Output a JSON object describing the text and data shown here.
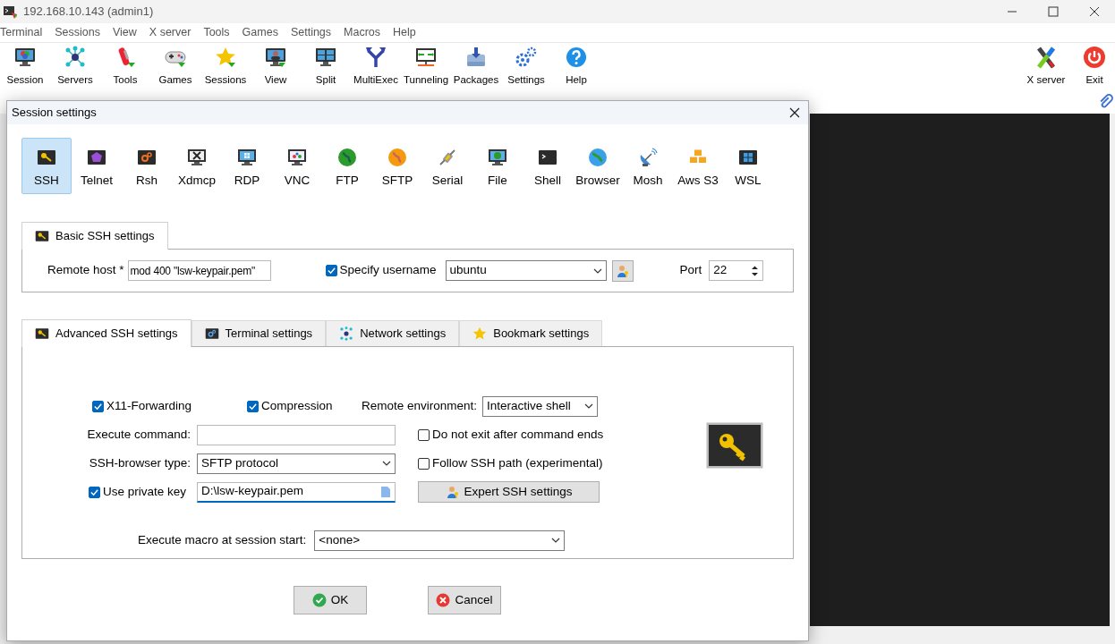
{
  "window": {
    "title": "192.168.10.143 (admin1)"
  },
  "menu": [
    "Terminal",
    "Sessions",
    "View",
    "X server",
    "Tools",
    "Games",
    "Settings",
    "Macros",
    "Help"
  ],
  "toolbar": [
    {
      "label": "Session",
      "kind": "session"
    },
    {
      "label": "Servers",
      "kind": "servers"
    },
    {
      "label": "Tools",
      "kind": "tools"
    },
    {
      "label": "Games",
      "kind": "games"
    },
    {
      "label": "Sessions",
      "kind": "sessions"
    },
    {
      "label": "View",
      "kind": "view"
    },
    {
      "label": "Split",
      "kind": "split"
    },
    {
      "label": "MultiExec",
      "kind": "multiexec"
    },
    {
      "label": "Tunneling",
      "kind": "tunneling"
    },
    {
      "label": "Packages",
      "kind": "packages"
    },
    {
      "label": "Settings",
      "kind": "settings"
    },
    {
      "label": "Help",
      "kind": "help"
    }
  ],
  "toolbar_right": [
    {
      "label": "X server",
      "kind": "xserver"
    },
    {
      "label": "Exit",
      "kind": "exit"
    }
  ],
  "dialog": {
    "title": "Session settings",
    "session_types": [
      {
        "label": "SSH",
        "kind": "ssh",
        "selected": true
      },
      {
        "label": "Telnet",
        "kind": "telnet",
        "selected": false
      },
      {
        "label": "Rsh",
        "kind": "rsh",
        "selected": false
      },
      {
        "label": "Xdmcp",
        "kind": "xdmcp",
        "selected": false
      },
      {
        "label": "RDP",
        "kind": "rdp",
        "selected": false
      },
      {
        "label": "VNC",
        "kind": "vnc",
        "selected": false
      },
      {
        "label": "FTP",
        "kind": "ftp",
        "selected": false
      },
      {
        "label": "SFTP",
        "kind": "sftp",
        "selected": false
      },
      {
        "label": "Serial",
        "kind": "serial",
        "selected": false
      },
      {
        "label": "File",
        "kind": "file",
        "selected": false
      },
      {
        "label": "Shell",
        "kind": "shell",
        "selected": false
      },
      {
        "label": "Browser",
        "kind": "browser",
        "selected": false
      },
      {
        "label": "Mosh",
        "kind": "mosh",
        "selected": false
      },
      {
        "label": "Aws S3",
        "kind": "awss3",
        "selected": false
      },
      {
        "label": "WSL",
        "kind": "wsl",
        "selected": false
      }
    ],
    "basic_tab": {
      "label": "Basic SSH settings"
    },
    "remote_host": {
      "label": "Remote host *",
      "value": "mod 400 \"lsw-keypair.pem\""
    },
    "specify_username": {
      "label": "Specify username",
      "checked": true
    },
    "username": {
      "value": "ubuntu"
    },
    "port": {
      "label": "Port",
      "value": "22"
    },
    "advanced_tabs": [
      {
        "label": "Advanced SSH settings",
        "kind": "ssh",
        "selected": true
      },
      {
        "label": "Terminal settings",
        "kind": "terminal",
        "selected": false
      },
      {
        "label": "Network settings",
        "kind": "network",
        "selected": false
      },
      {
        "label": "Bookmark settings",
        "kind": "bookmark",
        "selected": false
      }
    ],
    "x11_forwarding": {
      "label": "X11-Forwarding",
      "checked": true
    },
    "compression": {
      "label": "Compression",
      "checked": true
    },
    "remote_environment": {
      "label": "Remote environment:",
      "value": "Interactive shell"
    },
    "execute_command": {
      "label": "Execute command:"
    },
    "do_not_exit": {
      "label": "Do not exit after command ends",
      "checked": false
    },
    "ssh_browser_type": {
      "label": "SSH-browser type:",
      "value": "SFTP protocol"
    },
    "follow_ssh_path": {
      "label": "Follow SSH path (experimental)",
      "checked": false
    },
    "use_private_key": {
      "label": "Use private key",
      "checked": true,
      "value": "D:\\lsw-keypair.pem"
    },
    "expert_button": {
      "label": "Expert SSH settings"
    },
    "execute_macro": {
      "label": "Execute macro at session start:",
      "value": "<none>"
    },
    "buttons": [
      {
        "label": "OK",
        "kind": "ok"
      },
      {
        "label": "Cancel",
        "kind": "cancel"
      }
    ]
  }
}
